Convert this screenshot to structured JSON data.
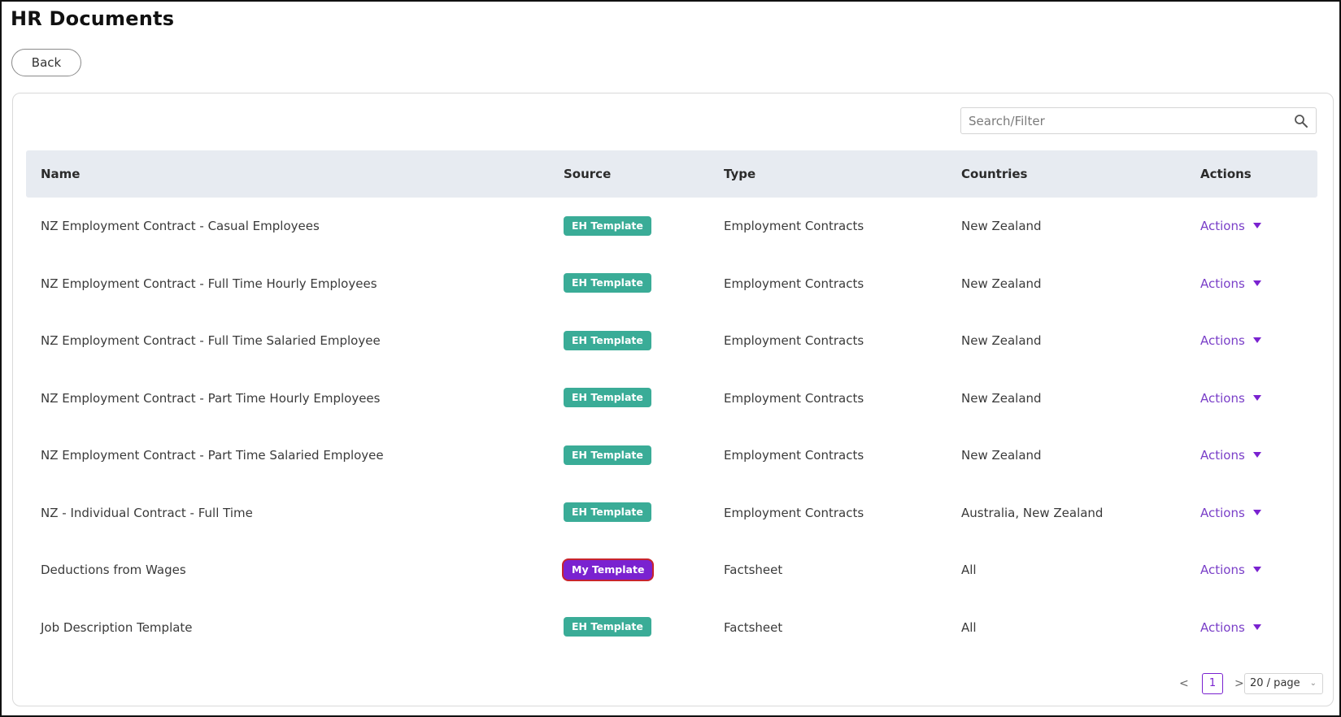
{
  "page": {
    "title": "HR Documents",
    "back_label": "Back"
  },
  "search": {
    "placeholder": "Search/Filter",
    "icon": "search-icon"
  },
  "table": {
    "headers": {
      "name": "Name",
      "source": "Source",
      "type": "Type",
      "countries": "Countries",
      "actions": "Actions"
    },
    "rows": [
      {
        "name": "NZ Employment Contract - Casual Employees",
        "source": "EH Template",
        "type": "Employment Contracts",
        "countries": "New Zealand",
        "actions": "Actions"
      },
      {
        "name": "NZ Employment Contract - Full Time Hourly Employees",
        "source": "EH Template",
        "type": "Employment Contracts",
        "countries": "New Zealand",
        "actions": "Actions"
      },
      {
        "name": "NZ Employment Contract - Full Time Salaried Employee",
        "source": "EH Template",
        "type": "Employment Contracts",
        "countries": "New Zealand",
        "actions": "Actions"
      },
      {
        "name": "NZ Employment Contract - Part Time Hourly Employees",
        "source": "EH Template",
        "type": "Employment Contracts",
        "countries": "New Zealand",
        "actions": "Actions"
      },
      {
        "name": "NZ Employment Contract - Part Time Salaried Employee",
        "source": "EH Template",
        "type": "Employment Contracts",
        "countries": "New Zealand",
        "actions": "Actions"
      },
      {
        "name": "NZ - Individual Contract - Full Time",
        "source": "EH Template",
        "type": "Employment Contracts",
        "countries": "Australia, New Zealand",
        "actions": "Actions"
      },
      {
        "name": "Deductions from Wages",
        "source": "My Template",
        "type": "Factsheet",
        "countries": "All",
        "actions": "Actions"
      },
      {
        "name": "Job Description Template",
        "source": "EH Template",
        "type": "Factsheet",
        "countries": "All",
        "actions": "Actions"
      }
    ]
  },
  "pagination": {
    "prev": "<",
    "current_page": "1",
    "next": ">",
    "page_size": "20 / page"
  },
  "colors": {
    "eh_template_badge": "#3aac97",
    "my_template_badge": "#7a22d0",
    "my_template_outline": "#c8242d",
    "actions_link": "#7a3fc8",
    "header_bg": "#e7ebf1"
  }
}
